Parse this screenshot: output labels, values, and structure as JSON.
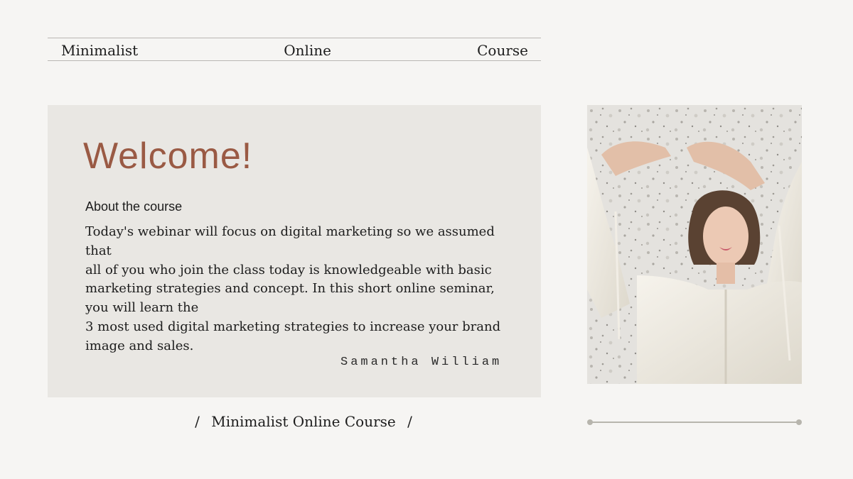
{
  "header": {
    "left": "Minimalist",
    "center": "Online",
    "right": "Course"
  },
  "card": {
    "title": "Welcome!",
    "subtitle": "About the course",
    "lines": [
      "Today's webinar will focus on digital marketing so we assumed",
      "that",
      "all of you who join the class today is knowledgeable with basic",
      "marketing strategies and concept. In this short online seminar,",
      "you will learn the",
      "3 most used digital marketing strategies to increase your brand",
      "image and sales."
    ],
    "signature": "Samantha William"
  },
  "footer": {
    "slash_left": "/",
    "label": "Minimalist Online Course",
    "slash_right": "/"
  },
  "colors": {
    "background": "#f6f5f3",
    "card": "#e9e7e3",
    "accent": "#9a5a44",
    "rule": "#b9b7b3"
  }
}
